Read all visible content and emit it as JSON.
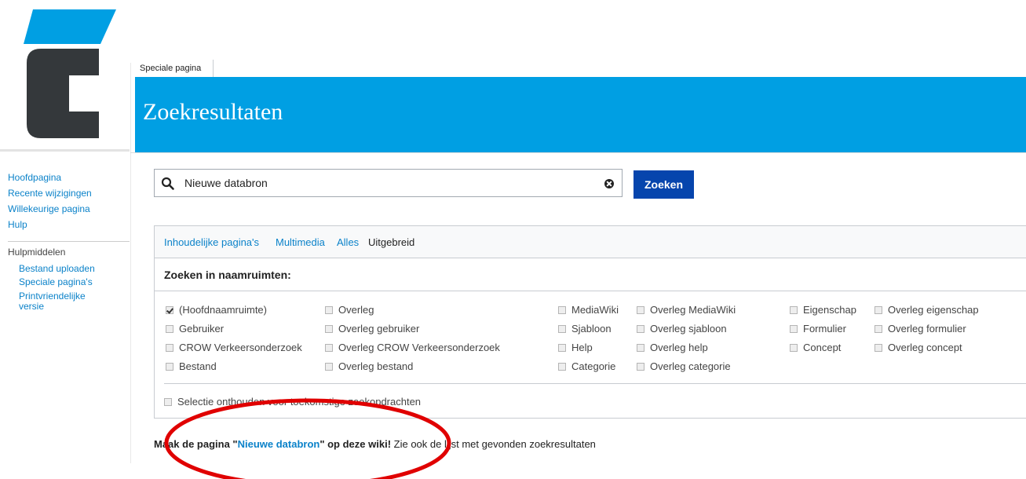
{
  "colors": {
    "brand_blue": "#009fe3",
    "link_blue": "#0b82c9",
    "button_blue": "#0645ad",
    "logo_dark": "#34383b",
    "annotation_red": "#e00000"
  },
  "sidebar": {
    "nav": [
      "Hoofdpagina",
      "Recente wijzigingen",
      "Willekeurige pagina",
      "Hulp"
    ],
    "tools_heading": "Hulpmiddelen",
    "tools": [
      "Bestand uploaden",
      "Speciale pagina's",
      "Printvriendelijke versie"
    ]
  },
  "tab": {
    "label": "Speciale pagina"
  },
  "page": {
    "title": "Zoekresultaten"
  },
  "search": {
    "value": "Nieuwe databron",
    "button_label": "Zoeken"
  },
  "profiles": [
    "Inhoudelijke pagina's",
    "Multimedia",
    "Alles",
    "Uitgebreid"
  ],
  "namespaces": {
    "heading": "Zoeken in naamruimten:",
    "col1": [
      {
        "label": "(Hoofdnaamruimte)",
        "checked": true
      },
      {
        "label": "Gebruiker"
      },
      {
        "label": "CROW Verkeersonderzoek"
      },
      {
        "label": "Bestand"
      }
    ],
    "col2": [
      {
        "label": "Overleg"
      },
      {
        "label": "Overleg gebruiker"
      },
      {
        "label": "Overleg CROW Verkeersonderzoek"
      },
      {
        "label": "Overleg bestand"
      }
    ],
    "col3": [
      {
        "label": "MediaWiki"
      },
      {
        "label": "Sjabloon"
      },
      {
        "label": "Help"
      },
      {
        "label": "Categorie"
      }
    ],
    "col4": [
      {
        "label": "Overleg MediaWiki"
      },
      {
        "label": "Overleg sjabloon"
      },
      {
        "label": "Overleg help"
      },
      {
        "label": "Overleg categorie"
      }
    ],
    "col5": [
      {
        "label": "Eigenschap"
      },
      {
        "label": "Formulier"
      },
      {
        "label": "Concept"
      }
    ],
    "col6": [
      {
        "label": "Overleg eigenschap"
      },
      {
        "label": "Overleg formulier"
      },
      {
        "label": "Overleg concept"
      }
    ],
    "remember": "Selectie onthouden voor toekomstige zoekopdrachten"
  },
  "suggestion": {
    "prefix": "Maak de pagina \"",
    "query": "Nieuwe databron",
    "suffix": "\" op deze wiki!",
    "rest": " Zie ook de lijst met gevonden zoekresultaten"
  }
}
